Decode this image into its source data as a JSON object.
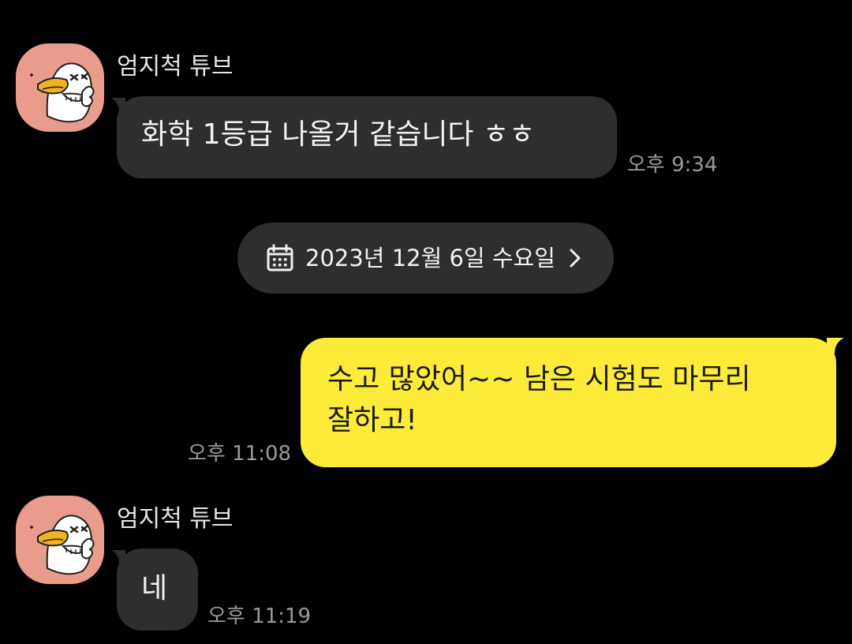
{
  "messages": [
    {
      "sender": "엄지척 튜브",
      "avatar_icon": "tube-duck-thumbs-up-avatar",
      "text": "화학 1등급 나올거 같습니다 ㅎㅎ",
      "time": "오후 9:34"
    },
    {
      "text_line1": "수고 많았어~~ 남은 시험도 마무리",
      "text_line2": "잘하고!",
      "time": "오후 11:08"
    },
    {
      "sender": "엄지척 튜브",
      "avatar_icon": "tube-duck-thumbs-up-avatar",
      "text": "네",
      "time": "오후 11:19"
    }
  ],
  "date_divider": {
    "icon": "calendar-icon",
    "label": "2023년 12월 6일 수요일",
    "chevron": "chevron-right-icon"
  },
  "colors": {
    "background": "#000000",
    "incoming_bubble": "#2e2e2e",
    "outgoing_bubble": "#fdeb3a",
    "avatar_bg": "#e99b8c",
    "timestamp": "#9a9a9a"
  }
}
